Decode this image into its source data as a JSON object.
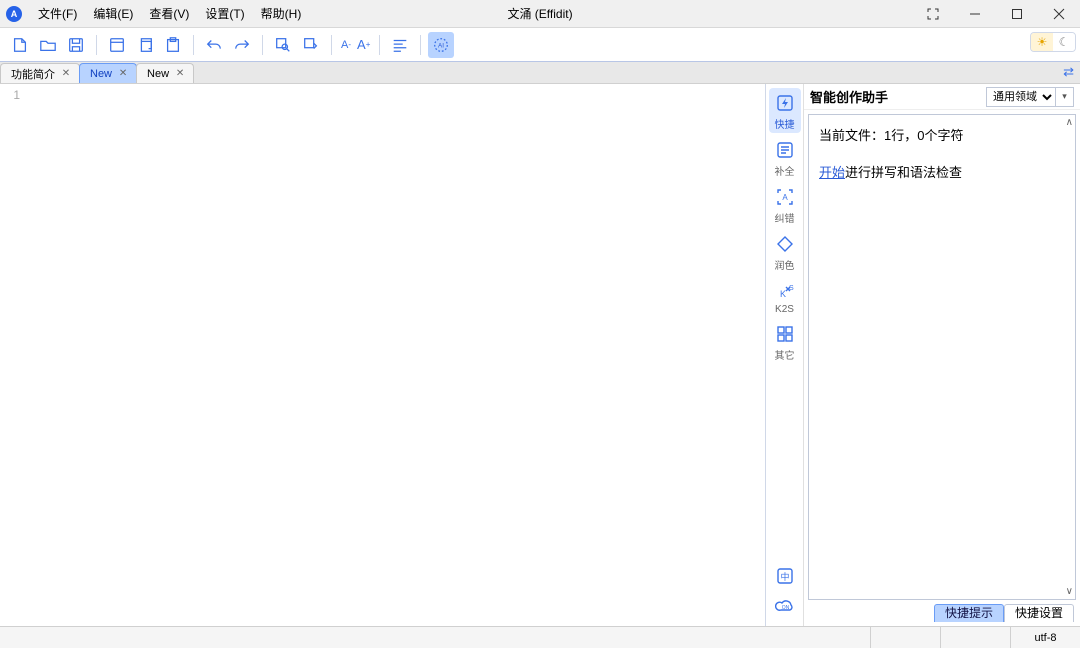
{
  "window": {
    "title": "文涌 (Effidit)",
    "logo_letter": "A"
  },
  "menus": [
    "文件(F)",
    "编辑(E)",
    "查看(V)",
    "设置(T)",
    "帮助(H)"
  ],
  "theme": {
    "light": "☀",
    "dark": "☾"
  },
  "tabs": [
    {
      "label": "功能简介",
      "active": false
    },
    {
      "label": "New",
      "active": true
    },
    {
      "label": "New",
      "active": false
    }
  ],
  "compare_icon": "⇄",
  "editor": {
    "line1": "1"
  },
  "rail": {
    "items": [
      {
        "key": "quick",
        "label": "快捷",
        "active": true
      },
      {
        "key": "complete",
        "label": "补全",
        "active": false
      },
      {
        "key": "correct",
        "label": "纠错",
        "active": false
      },
      {
        "key": "polish",
        "label": "润色",
        "active": false
      },
      {
        "key": "k2s",
        "label": "K2S",
        "active": false
      },
      {
        "key": "other",
        "label": "其它",
        "active": false
      }
    ]
  },
  "assistant": {
    "title": "智能创作助手",
    "domain_selected": "通用领域",
    "file_info": "当前文件：1行，0个字符",
    "action_link": "开始",
    "action_rest": "进行拼写和语法检查",
    "tab_hint": "快捷提示",
    "tab_settings": "快捷设置"
  },
  "status": {
    "encoding": "utf-8"
  }
}
